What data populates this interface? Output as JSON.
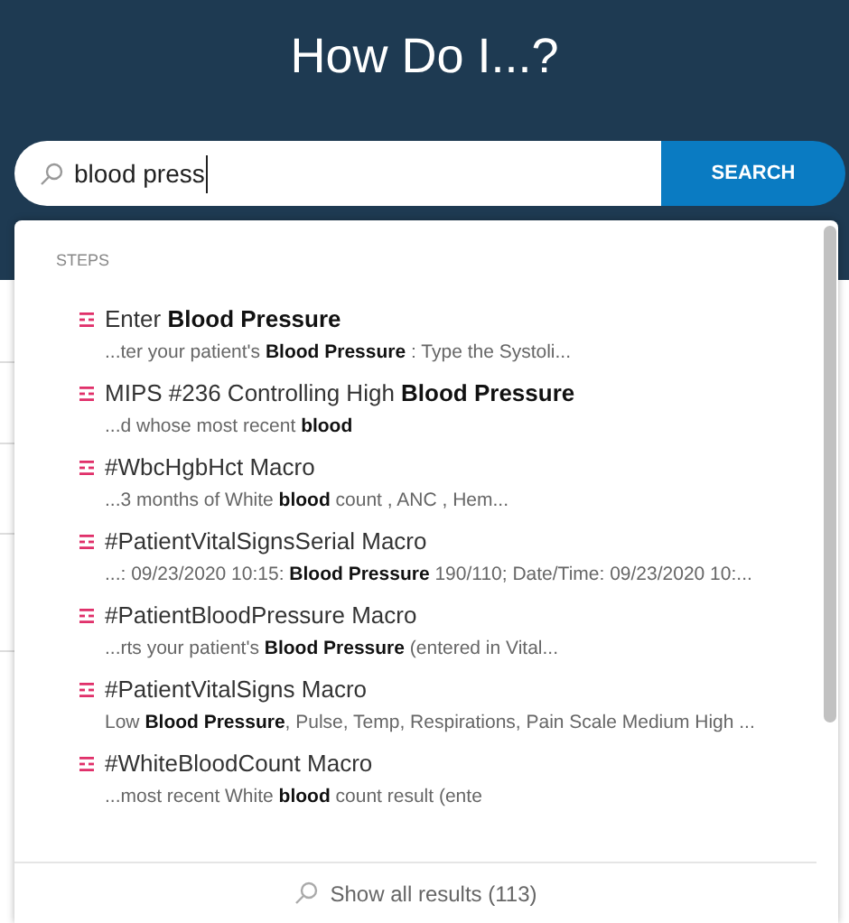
{
  "header": {
    "title": "How Do I...?"
  },
  "search": {
    "value": "blood press",
    "button": "SEARCH"
  },
  "dropdown": {
    "section": "STEPS",
    "results": [
      {
        "title": "Enter **Blood Pressure**",
        "snippet": "...ter your patient's **Blood Pressure** : Type the Systoli..."
      },
      {
        "title": "MIPS #236 Controlling High **Blood Pressure**",
        "snippet": "...d whose most recent **blood**"
      },
      {
        "title": "#WbcHgbHct Macro",
        "snippet": "...3 months of White **blood** count , ANC , Hem..."
      },
      {
        "title": "#PatientVitalSignsSerial Macro",
        "snippet": "...: 09/23/2020 10:15: **Blood Pressure** 190/110; Date/Time: 09/23/2020 10:..."
      },
      {
        "title": "#PatientBloodPressure Macro",
        "snippet": "...rts your patient's **Blood Pressure** (entered in Vital..."
      },
      {
        "title": "#PatientVitalSigns Macro",
        "snippet": "Low **Blood Pressure**, Pulse, Temp, Respirations, Pain Scale Medium High ..."
      },
      {
        "title": "#WhiteBloodCount Macro",
        "snippet": "...most recent White **blood** count result (ente"
      }
    ],
    "footer": "Show all results (113)"
  }
}
